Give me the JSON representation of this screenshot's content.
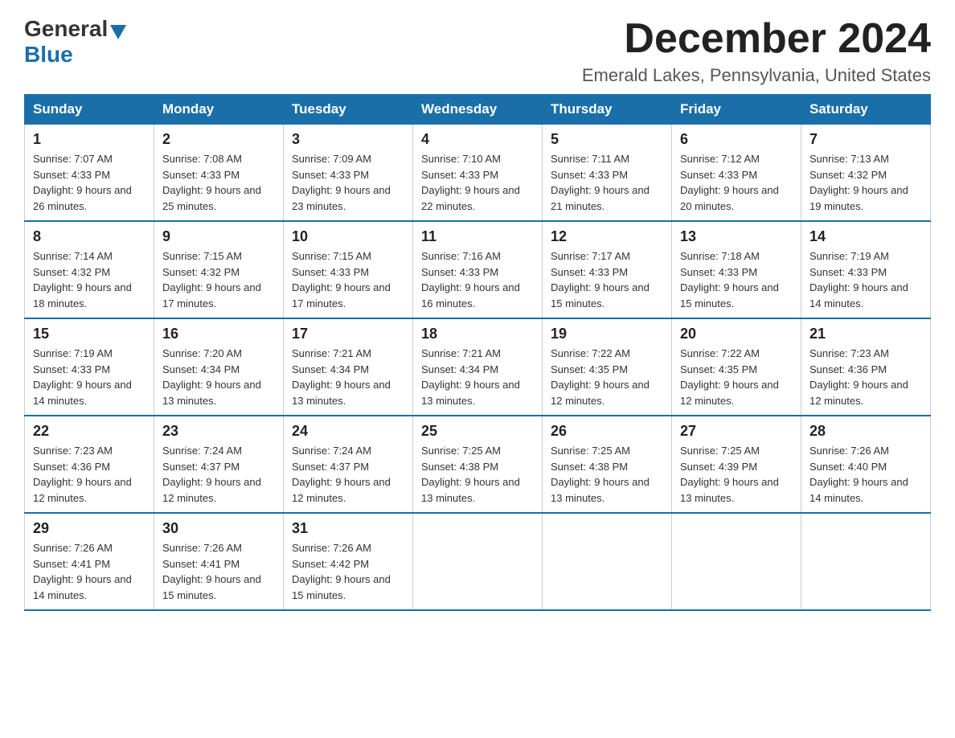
{
  "logo": {
    "general": "General",
    "blue": "Blue"
  },
  "title": "December 2024",
  "location": "Emerald Lakes, Pennsylvania, United States",
  "weekdays": [
    "Sunday",
    "Monday",
    "Tuesday",
    "Wednesday",
    "Thursday",
    "Friday",
    "Saturday"
  ],
  "weeks": [
    [
      {
        "day": "1",
        "sunrise": "7:07 AM",
        "sunset": "4:33 PM",
        "daylight": "9 hours and 26 minutes."
      },
      {
        "day": "2",
        "sunrise": "7:08 AM",
        "sunset": "4:33 PM",
        "daylight": "9 hours and 25 minutes."
      },
      {
        "day": "3",
        "sunrise": "7:09 AM",
        "sunset": "4:33 PM",
        "daylight": "9 hours and 23 minutes."
      },
      {
        "day": "4",
        "sunrise": "7:10 AM",
        "sunset": "4:33 PM",
        "daylight": "9 hours and 22 minutes."
      },
      {
        "day": "5",
        "sunrise": "7:11 AM",
        "sunset": "4:33 PM",
        "daylight": "9 hours and 21 minutes."
      },
      {
        "day": "6",
        "sunrise": "7:12 AM",
        "sunset": "4:33 PM",
        "daylight": "9 hours and 20 minutes."
      },
      {
        "day": "7",
        "sunrise": "7:13 AM",
        "sunset": "4:32 PM",
        "daylight": "9 hours and 19 minutes."
      }
    ],
    [
      {
        "day": "8",
        "sunrise": "7:14 AM",
        "sunset": "4:32 PM",
        "daylight": "9 hours and 18 minutes."
      },
      {
        "day": "9",
        "sunrise": "7:15 AM",
        "sunset": "4:32 PM",
        "daylight": "9 hours and 17 minutes."
      },
      {
        "day": "10",
        "sunrise": "7:15 AM",
        "sunset": "4:33 PM",
        "daylight": "9 hours and 17 minutes."
      },
      {
        "day": "11",
        "sunrise": "7:16 AM",
        "sunset": "4:33 PM",
        "daylight": "9 hours and 16 minutes."
      },
      {
        "day": "12",
        "sunrise": "7:17 AM",
        "sunset": "4:33 PM",
        "daylight": "9 hours and 15 minutes."
      },
      {
        "day": "13",
        "sunrise": "7:18 AM",
        "sunset": "4:33 PM",
        "daylight": "9 hours and 15 minutes."
      },
      {
        "day": "14",
        "sunrise": "7:19 AM",
        "sunset": "4:33 PM",
        "daylight": "9 hours and 14 minutes."
      }
    ],
    [
      {
        "day": "15",
        "sunrise": "7:19 AM",
        "sunset": "4:33 PM",
        "daylight": "9 hours and 14 minutes."
      },
      {
        "day": "16",
        "sunrise": "7:20 AM",
        "sunset": "4:34 PM",
        "daylight": "9 hours and 13 minutes."
      },
      {
        "day": "17",
        "sunrise": "7:21 AM",
        "sunset": "4:34 PM",
        "daylight": "9 hours and 13 minutes."
      },
      {
        "day": "18",
        "sunrise": "7:21 AM",
        "sunset": "4:34 PM",
        "daylight": "9 hours and 13 minutes."
      },
      {
        "day": "19",
        "sunrise": "7:22 AM",
        "sunset": "4:35 PM",
        "daylight": "9 hours and 12 minutes."
      },
      {
        "day": "20",
        "sunrise": "7:22 AM",
        "sunset": "4:35 PM",
        "daylight": "9 hours and 12 minutes."
      },
      {
        "day": "21",
        "sunrise": "7:23 AM",
        "sunset": "4:36 PM",
        "daylight": "9 hours and 12 minutes."
      }
    ],
    [
      {
        "day": "22",
        "sunrise": "7:23 AM",
        "sunset": "4:36 PM",
        "daylight": "9 hours and 12 minutes."
      },
      {
        "day": "23",
        "sunrise": "7:24 AM",
        "sunset": "4:37 PM",
        "daylight": "9 hours and 12 minutes."
      },
      {
        "day": "24",
        "sunrise": "7:24 AM",
        "sunset": "4:37 PM",
        "daylight": "9 hours and 12 minutes."
      },
      {
        "day": "25",
        "sunrise": "7:25 AM",
        "sunset": "4:38 PM",
        "daylight": "9 hours and 13 minutes."
      },
      {
        "day": "26",
        "sunrise": "7:25 AM",
        "sunset": "4:38 PM",
        "daylight": "9 hours and 13 minutes."
      },
      {
        "day": "27",
        "sunrise": "7:25 AM",
        "sunset": "4:39 PM",
        "daylight": "9 hours and 13 minutes."
      },
      {
        "day": "28",
        "sunrise": "7:26 AM",
        "sunset": "4:40 PM",
        "daylight": "9 hours and 14 minutes."
      }
    ],
    [
      {
        "day": "29",
        "sunrise": "7:26 AM",
        "sunset": "4:41 PM",
        "daylight": "9 hours and 14 minutes."
      },
      {
        "day": "30",
        "sunrise": "7:26 AM",
        "sunset": "4:41 PM",
        "daylight": "9 hours and 15 minutes."
      },
      {
        "day": "31",
        "sunrise": "7:26 AM",
        "sunset": "4:42 PM",
        "daylight": "9 hours and 15 minutes."
      },
      null,
      null,
      null,
      null
    ]
  ],
  "labels": {
    "sunrise_prefix": "Sunrise: ",
    "sunset_prefix": "Sunset: ",
    "daylight_prefix": "Daylight: "
  }
}
